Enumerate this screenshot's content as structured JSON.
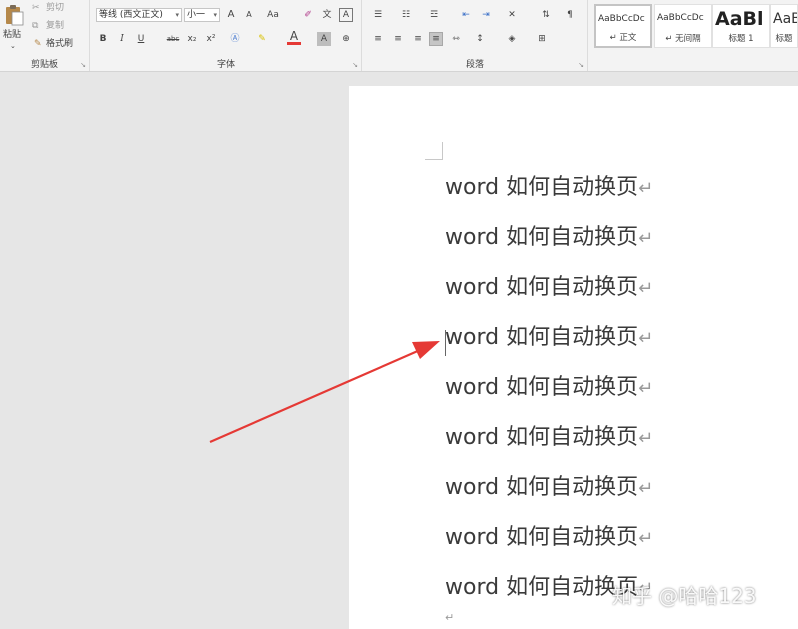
{
  "ribbon": {
    "clipboard": {
      "paste_label": "粘贴",
      "cut_label": "剪切",
      "copy_label": "复制",
      "format_painter_label": "格式刷",
      "group_label": "剪贴板"
    },
    "font": {
      "font_name": "等线 (西文正文)",
      "font_size": "小一",
      "bold": "B",
      "italic": "I",
      "underline": "U",
      "strikethrough": "abc",
      "subscript": "x₂",
      "superscript": "x²",
      "grow": "A",
      "shrink": "A",
      "change_case": "Aa",
      "font_color_glyph": "A",
      "char_shading": "A",
      "char_border": "A",
      "phonetic": "文",
      "enclosed": "字",
      "group_label": "字体"
    },
    "paragraph": {
      "group_label": "段落"
    },
    "styles": {
      "items": [
        {
          "sample": "AaBbCcDc",
          "name": "↵ 正文"
        },
        {
          "sample": "AaBbCcDc",
          "name": "↵ 无间隔"
        },
        {
          "sample": "AaBl",
          "name": "标题 1"
        },
        {
          "sample": "AaBb",
          "name": "标题"
        }
      ]
    }
  },
  "document": {
    "lines": [
      "word 如何自动换页",
      "word 如何自动换页",
      "word 如何自动换页",
      "word 如何自动换页",
      "word 如何自动换页",
      "word 如何自动换页",
      "word 如何自动换页",
      "word 如何自动换页",
      "word 如何自动换页"
    ],
    "paragraph_mark": "↵",
    "end_mark": "↵"
  },
  "watermark": "知乎 @哈哈123",
  "colors": {
    "arrow": "#e53935",
    "ribbon_bg": "#f3f3f3",
    "canvas_bg": "#e6e6e6",
    "page_bg": "#ffffff"
  }
}
